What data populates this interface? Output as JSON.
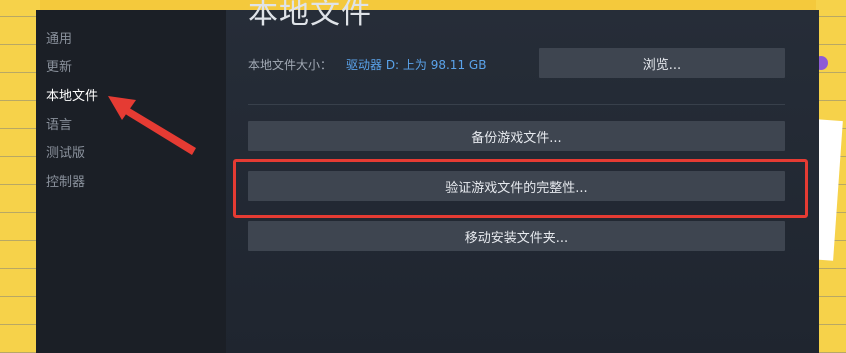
{
  "sidebar": {
    "items": [
      {
        "label": "通用"
      },
      {
        "label": "更新"
      },
      {
        "label": "本地文件"
      },
      {
        "label": "语言"
      },
      {
        "label": "测试版"
      },
      {
        "label": "控制器"
      }
    ],
    "active_index": 2
  },
  "main": {
    "heading": "本地文件",
    "size_label": "本地文件大小：",
    "size_value": "驱动器 D: 上为 98.11 GB",
    "browse_label": "浏览...",
    "backup_label": "备份游戏文件...",
    "verify_label": "验证游戏文件的完整性...",
    "move_label": "移动安装文件夹..."
  },
  "colors": {
    "accent_link": "#5aa3ea",
    "highlight": "#e53b33",
    "button_bg": "#3e4550",
    "window_bg": "#1c222c"
  }
}
